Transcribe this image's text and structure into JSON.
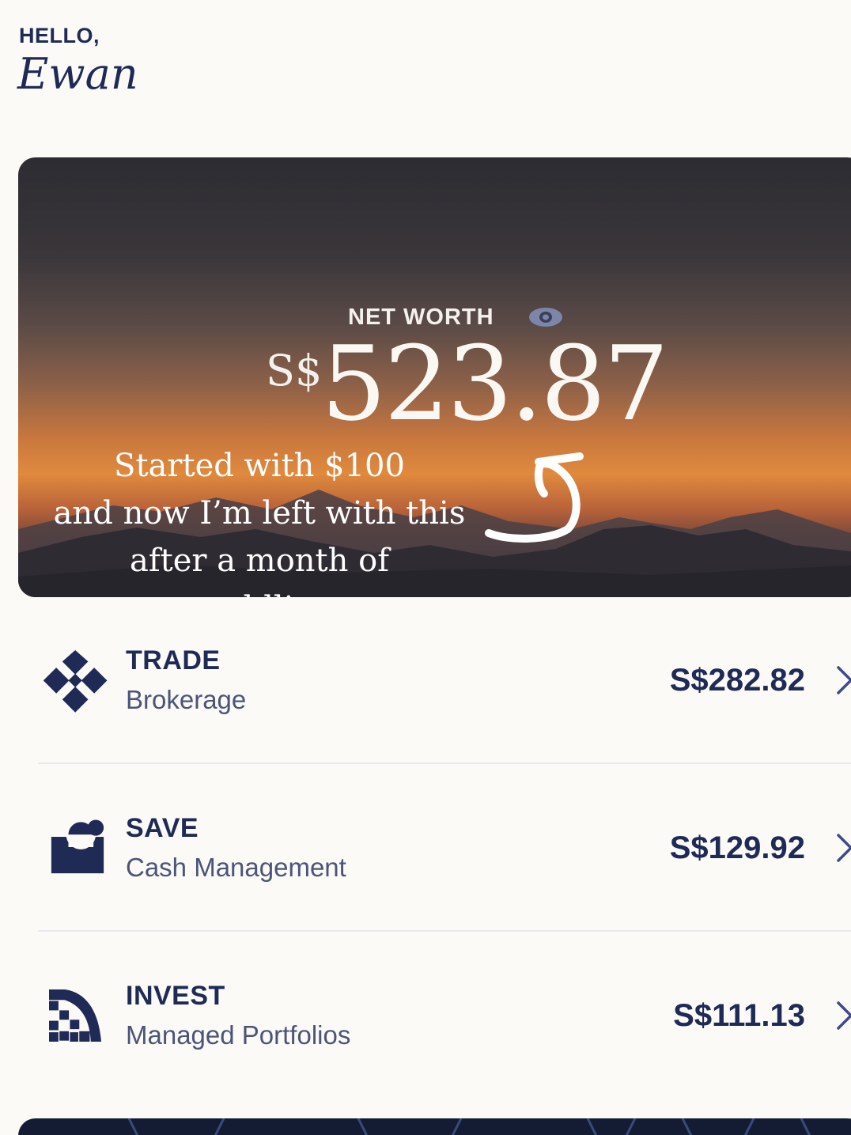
{
  "greeting": {
    "hello": "HELLO,",
    "name": "Ewan"
  },
  "net_worth": {
    "label": "NET WORTH",
    "currency": "S$",
    "amount": "523.87",
    "visibility_icon": "eye-icon"
  },
  "overlay_caption": {
    "line1": "Started with $100",
    "line2": "and now I’m left with this",
    "line3": "after a month of meddling"
  },
  "accounts": [
    {
      "title": "TRADE",
      "subtitle": "Brokerage",
      "value": "S$282.82",
      "icon": "trade-icon"
    },
    {
      "title": "SAVE",
      "subtitle": "Cash Management",
      "value": "S$129.92",
      "icon": "save-icon"
    },
    {
      "title": "INVEST",
      "subtitle": "Managed Portfolios",
      "value": "S$111.13",
      "icon": "invest-icon"
    }
  ],
  "colors": {
    "navy": "#1f2a55",
    "background": "#fbfaf7",
    "sunset": "#e08a3d"
  }
}
